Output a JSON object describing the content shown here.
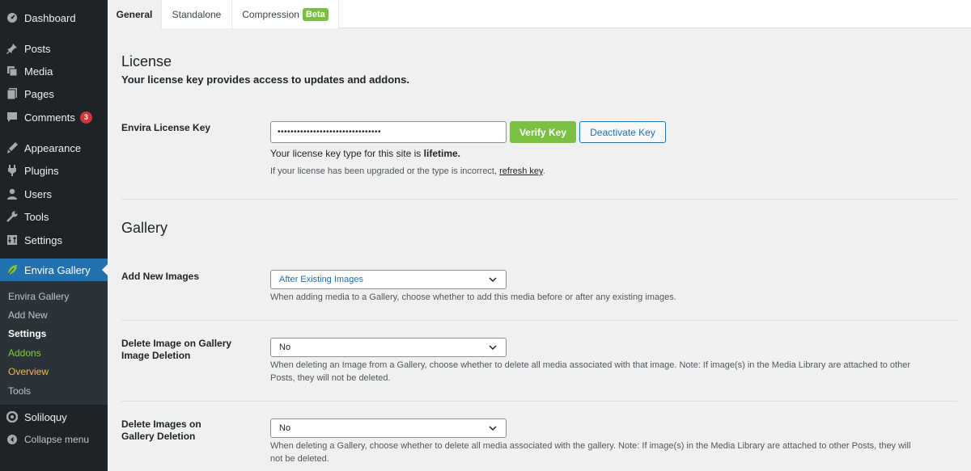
{
  "sidebar": {
    "items": [
      {
        "label": "Dashboard",
        "icon": "dashboard-icon"
      },
      {
        "label": "Posts",
        "icon": "pin-icon"
      },
      {
        "label": "Media",
        "icon": "media-icon"
      },
      {
        "label": "Pages",
        "icon": "pages-icon"
      },
      {
        "label": "Comments",
        "icon": "comments-icon",
        "badge": "3"
      },
      {
        "label": "Appearance",
        "icon": "appearance-icon"
      },
      {
        "label": "Plugins",
        "icon": "plugins-icon"
      },
      {
        "label": "Users",
        "icon": "users-icon"
      },
      {
        "label": "Tools",
        "icon": "tools-icon"
      },
      {
        "label": "Settings",
        "icon": "settings-icon"
      },
      {
        "label": "Envira Gallery",
        "icon": "leaf-icon"
      },
      {
        "label": "Soliloquy",
        "icon": "soliloquy-icon"
      },
      {
        "label": "Collapse menu",
        "icon": "collapse-icon"
      }
    ],
    "submenu": [
      "Envira Gallery",
      "Add New",
      "Settings",
      "Addons",
      "Overview",
      "Tools"
    ]
  },
  "tabs": [
    {
      "label": "General"
    },
    {
      "label": "Standalone"
    },
    {
      "label": "Compression",
      "badge": "Beta"
    }
  ],
  "license": {
    "title": "License",
    "description": "Your license key provides access to updates and addons.",
    "field_label": "Envira License Key",
    "key_value": "••••••••••••••••••••••••••••••••",
    "verify_label": "Verify Key",
    "deactivate_label": "Deactivate Key",
    "type_prefix": "Your license key type for this site is ",
    "type_value": "lifetime.",
    "upgrade_text": "If your license has been upgraded or the type is incorrect, ",
    "refresh_link": "refresh key",
    "upgrade_end": "."
  },
  "gallery": {
    "title": "Gallery",
    "fields": [
      {
        "label_line1": "Add New Images",
        "label_line2": "",
        "value": "After Existing Images",
        "help_line1": "When adding media to a Gallery, choose whether to add this media before or after any existing images.",
        "help_line2": ""
      },
      {
        "label_line1": "Delete Image on Gallery",
        "label_line2": "Image Deletion",
        "value": "No",
        "help_line1": "When deleting an Image from a Gallery, choose whether to delete all media associated with that image. Note: If image(s) in the Media Library are attached to other",
        "help_line2": "Posts, they will not be deleted."
      },
      {
        "label_line1": "Delete Images on",
        "label_line2": "Gallery Deletion",
        "value": "No",
        "help_line1": "When deleting a Gallery, choose whether to delete all media associated with the gallery. Note: If image(s) in the Media Library are attached to other Posts, they will",
        "help_line2": "not be deleted."
      }
    ]
  },
  "colors": {
    "sidebar_bg": "#1d2327",
    "active_menu": "#2271b1",
    "envira_green": "#7ac143",
    "badge_red": "#d63638"
  }
}
